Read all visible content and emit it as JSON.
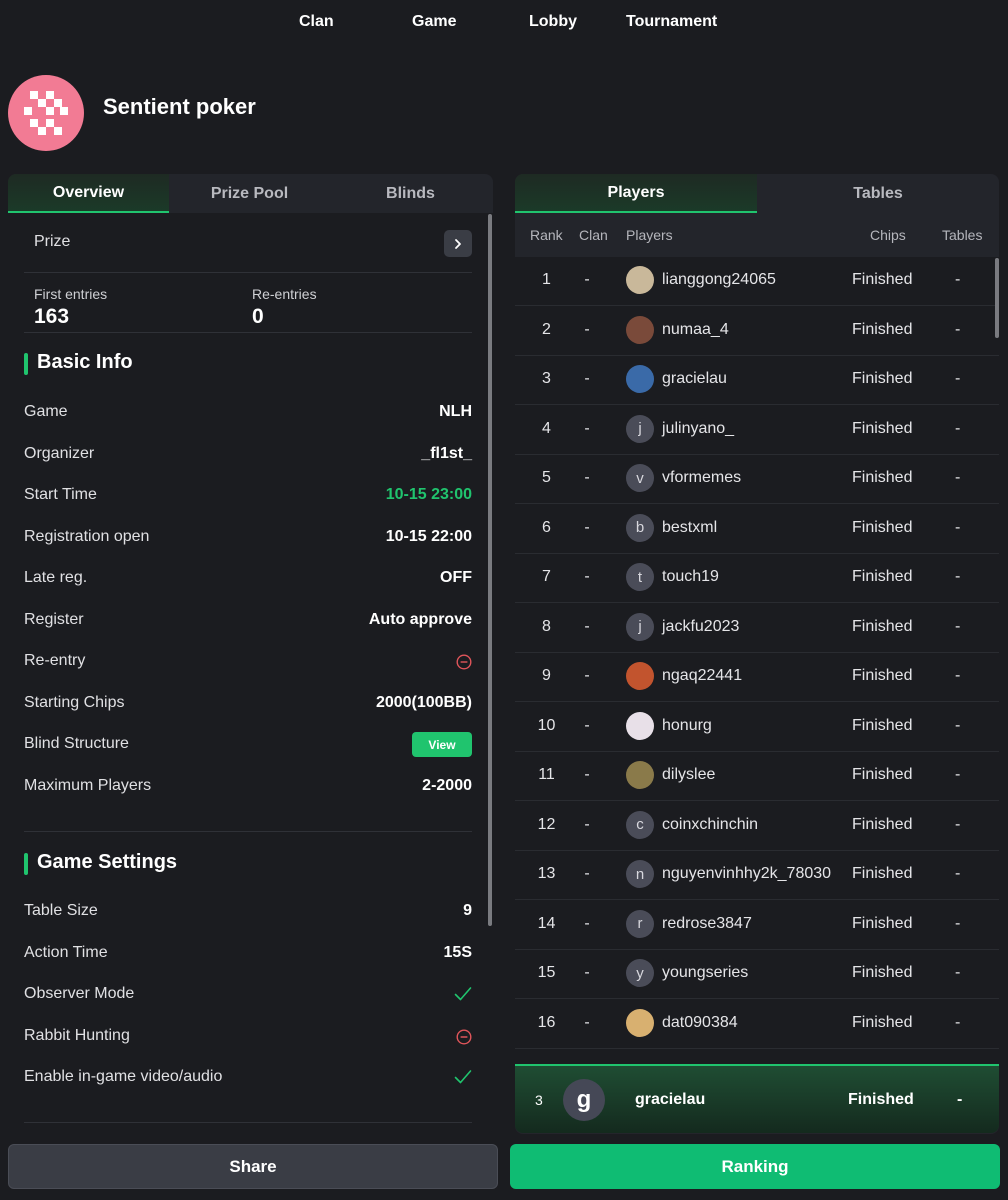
{
  "nav": {
    "items": [
      "Clan",
      "Game",
      "Lobby",
      "Tournament"
    ]
  },
  "header": {
    "title": "Sentient poker"
  },
  "left_tabs": [
    "Overview",
    "Prize Pool",
    "Blinds"
  ],
  "prize": {
    "label": "Prize"
  },
  "entries": {
    "first_label": "First entries",
    "first_value": "163",
    "re_label": "Re-entries",
    "re_value": "0"
  },
  "basic_info": {
    "title": "Basic Info",
    "game_label": "Game",
    "game_value": "NLH",
    "organizer_label": "Organizer",
    "organizer_value": "_fl1st_",
    "start_label": "Start Time",
    "start_value": "10-15 23:00",
    "regopen_label": "Registration open",
    "regopen_value": "10-15 22:00",
    "latereg_label": "Late reg.",
    "latereg_value": "OFF",
    "register_label": "Register",
    "register_value": "Auto approve",
    "reentry_label": "Re-entry",
    "chips_label": "Starting Chips",
    "chips_value": "2000(100BB)",
    "blind_label": "Blind Structure",
    "blind_button": "View",
    "max_label": "Maximum Players",
    "max_value": "2-2000"
  },
  "game_settings": {
    "title": "Game Settings",
    "table_label": "Table Size",
    "table_value": "9",
    "action_label": "Action Time",
    "action_value": "15S",
    "observer_label": "Observer Mode",
    "rabbit_label": "Rabbit Hunting",
    "video_label": "Enable in-game video/audio"
  },
  "right_tabs": [
    "Players",
    "Tables"
  ],
  "columns": {
    "rank": "Rank",
    "clan": "Clan",
    "players": "Players",
    "chips": "Chips",
    "tables": "Tables"
  },
  "players": [
    {
      "rank": "1",
      "clan": "-",
      "name": "lianggong24065",
      "chips": "Finished",
      "tables": "-",
      "initial": "",
      "color": "#c9b89a"
    },
    {
      "rank": "2",
      "clan": "-",
      "name": "numaa_4",
      "chips": "Finished",
      "tables": "-",
      "initial": "",
      "color": "#7a4a3a"
    },
    {
      "rank": "3",
      "clan": "-",
      "name": "gracielau",
      "chips": "Finished",
      "tables": "-",
      "initial": "",
      "color": "#3a6aa8"
    },
    {
      "rank": "4",
      "clan": "-",
      "name": "julinyano_",
      "chips": "Finished",
      "tables": "-",
      "initial": "j",
      "color": "#4a4c58"
    },
    {
      "rank": "5",
      "clan": "-",
      "name": "vformemes",
      "chips": "Finished",
      "tables": "-",
      "initial": "v",
      "color": "#4a4c58"
    },
    {
      "rank": "6",
      "clan": "-",
      "name": "bestxml",
      "chips": "Finished",
      "tables": "-",
      "initial": "b",
      "color": "#4a4c58"
    },
    {
      "rank": "7",
      "clan": "-",
      "name": "touch19",
      "chips": "Finished",
      "tables": "-",
      "initial": "t",
      "color": "#4a4c58"
    },
    {
      "rank": "8",
      "clan": "-",
      "name": "jackfu2023",
      "chips": "Finished",
      "tables": "-",
      "initial": "j",
      "color": "#4a4c58"
    },
    {
      "rank": "9",
      "clan": "-",
      "name": "ngaq22441",
      "chips": "Finished",
      "tables": "-",
      "initial": "",
      "color": "#c2542e"
    },
    {
      "rank": "10",
      "clan": "-",
      "name": "honurg",
      "chips": "Finished",
      "tables": "-",
      "initial": "",
      "color": "#e8e0e8"
    },
    {
      "rank": "11",
      "clan": "-",
      "name": "dilyslee",
      "chips": "Finished",
      "tables": "-",
      "initial": "",
      "color": "#8a7a4a"
    },
    {
      "rank": "12",
      "clan": "-",
      "name": "coinxchinchin",
      "chips": "Finished",
      "tables": "-",
      "initial": "c",
      "color": "#4a4c58"
    },
    {
      "rank": "13",
      "clan": "-",
      "name": "nguyenvinhhy2k_78030",
      "chips": "Finished",
      "tables": "-",
      "initial": "n",
      "color": "#4a4c58"
    },
    {
      "rank": "14",
      "clan": "-",
      "name": "redrose3847",
      "chips": "Finished",
      "tables": "-",
      "initial": "r",
      "color": "#4a4c58"
    },
    {
      "rank": "15",
      "clan": "-",
      "name": "youngseries",
      "chips": "Finished",
      "tables": "-",
      "initial": "y",
      "color": "#4a4c58"
    },
    {
      "rank": "16",
      "clan": "-",
      "name": "dat090384",
      "chips": "Finished",
      "tables": "-",
      "initial": "",
      "color": "#d8b070"
    }
  ],
  "my_row": {
    "rank": "3",
    "initial": "g",
    "name": "gracielau",
    "chips": "Finished",
    "tables": "-"
  },
  "buttons": {
    "share": "Share",
    "ranking": "Ranking"
  },
  "colors": {
    "accent": "#20c46e",
    "background": "#1b1c20",
    "logo": "#f27b94",
    "warn": "#e0555a"
  }
}
